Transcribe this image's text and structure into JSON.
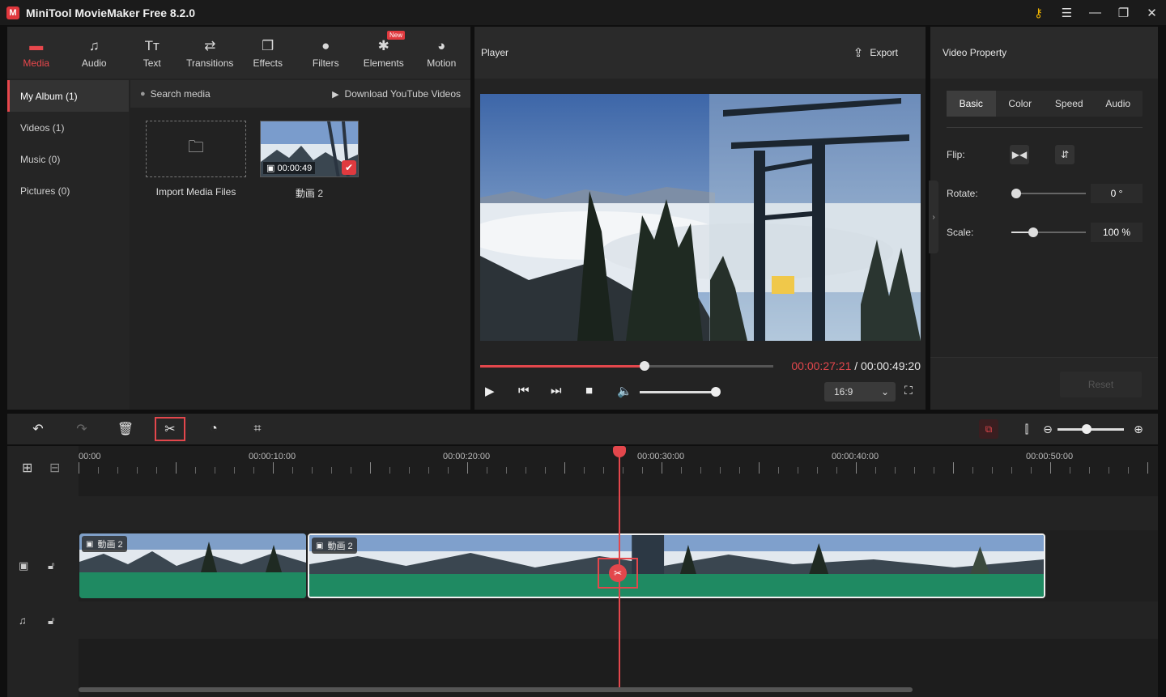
{
  "app": {
    "title": "MiniTool MovieMaker Free 8.2.0"
  },
  "tabs": [
    {
      "label": "Media",
      "icon": "media-icon"
    },
    {
      "label": "Audio",
      "icon": "music-icon"
    },
    {
      "label": "Text",
      "icon": "text-icon"
    },
    {
      "label": "Transitions",
      "icon": "transitions-icon"
    },
    {
      "label": "Effects",
      "icon": "effects-icon"
    },
    {
      "label": "Filters",
      "icon": "filters-icon"
    },
    {
      "label": "Elements",
      "icon": "elements-icon",
      "badge": "New"
    },
    {
      "label": "Motion",
      "icon": "motion-icon"
    }
  ],
  "sidebar": {
    "items": [
      "My Album (1)",
      "Videos (1)",
      "Music (0)",
      "Pictures (0)"
    ]
  },
  "media": {
    "search_label": "Search media",
    "youtube_label": "Download YouTube Videos",
    "import_label": "Import Media Files",
    "clip_name": "動画 2",
    "clip_duration": "00:00:49"
  },
  "player": {
    "title": "Player",
    "export_label": "Export",
    "current_time": "00:00:27:21",
    "total_time": " / 00:00:49:20",
    "progress": 0.56,
    "volume": 1.0,
    "ratio": "16:9"
  },
  "property": {
    "title": "Video Property",
    "tabs": [
      "Basic",
      "Color",
      "Speed",
      "Audio"
    ],
    "flip_label": "Flip:",
    "rotate_label": "Rotate:",
    "rotate_value": "0 °",
    "scale_label": "Scale:",
    "scale_value": "100 %",
    "reset_label": "Reset"
  },
  "timeline": {
    "ticks": [
      "00:00",
      "00:00:10:00",
      "00:00:20:00",
      "00:00:30:00",
      "00:00:40:00",
      "00:00:50:00"
    ],
    "clips": [
      {
        "name": "動画 2"
      },
      {
        "name": "動画 2"
      }
    ]
  },
  "colors": {
    "accent": "#e3474c",
    "wave": "#1f8a62"
  }
}
